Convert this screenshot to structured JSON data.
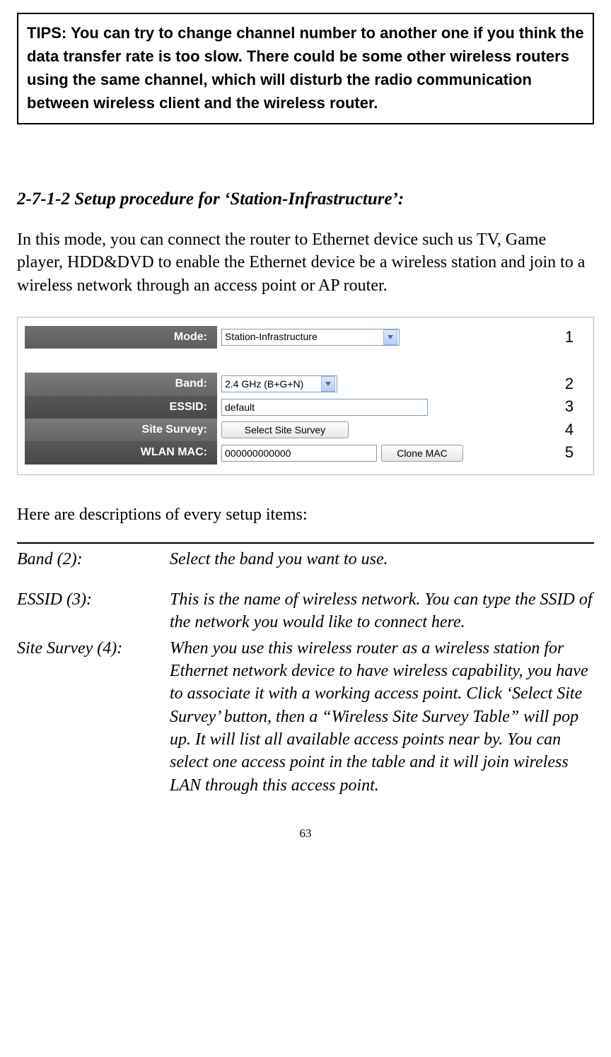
{
  "tips": "TIPS: You can try to change channel number to another one if you think the data transfer rate is too slow. There could be some other wireless routers using the same channel, which will disturb the radio communication between wireless client and the wireless router.",
  "heading": "2-7-1-2 Setup procedure for ‘Station-Infrastructure’:",
  "intro_paragraph": "In this mode, you can connect the router to Ethernet device such us TV, Game player, HDD&DVD to enable the Ethernet device be a wireless station and join to a wireless network through an access point or AP router.",
  "form": {
    "rows": {
      "mode": {
        "label": "Mode:",
        "value": "Station-Infrastructure",
        "num": "1"
      },
      "band": {
        "label": "Band:",
        "value": "2.4 GHz (B+G+N)",
        "num": "2"
      },
      "essid": {
        "label": "ESSID:",
        "value": "default",
        "num": "3"
      },
      "site_survey": {
        "label": "Site Survey:",
        "button": "Select Site Survey",
        "num": "4"
      },
      "wlan_mac": {
        "label": "WLAN MAC:",
        "value": "000000000000",
        "button": "Clone MAC",
        "num": "5"
      }
    }
  },
  "desc_intro": "Here are descriptions of every setup items:",
  "descriptions": {
    "band": {
      "term": "Band (2):",
      "def": "Select the band you want to use."
    },
    "essid": {
      "term": "ESSID (3):",
      "def": "This is the name of wireless network. You can type the SSID of the network you would like to connect here."
    },
    "site_survey": {
      "term": "Site Survey (4):",
      "def": "When you use this wireless router as a wireless station for Ethernet network device to have wireless capability, you have to associate it with a working access point. Click ‘Select Site Survey’ button, then a “Wireless Site Survey Table” will pop up. It will list all available access points near by. You can select one access point in the table and it will join wireless LAN through this access point."
    }
  },
  "page_number": "63"
}
